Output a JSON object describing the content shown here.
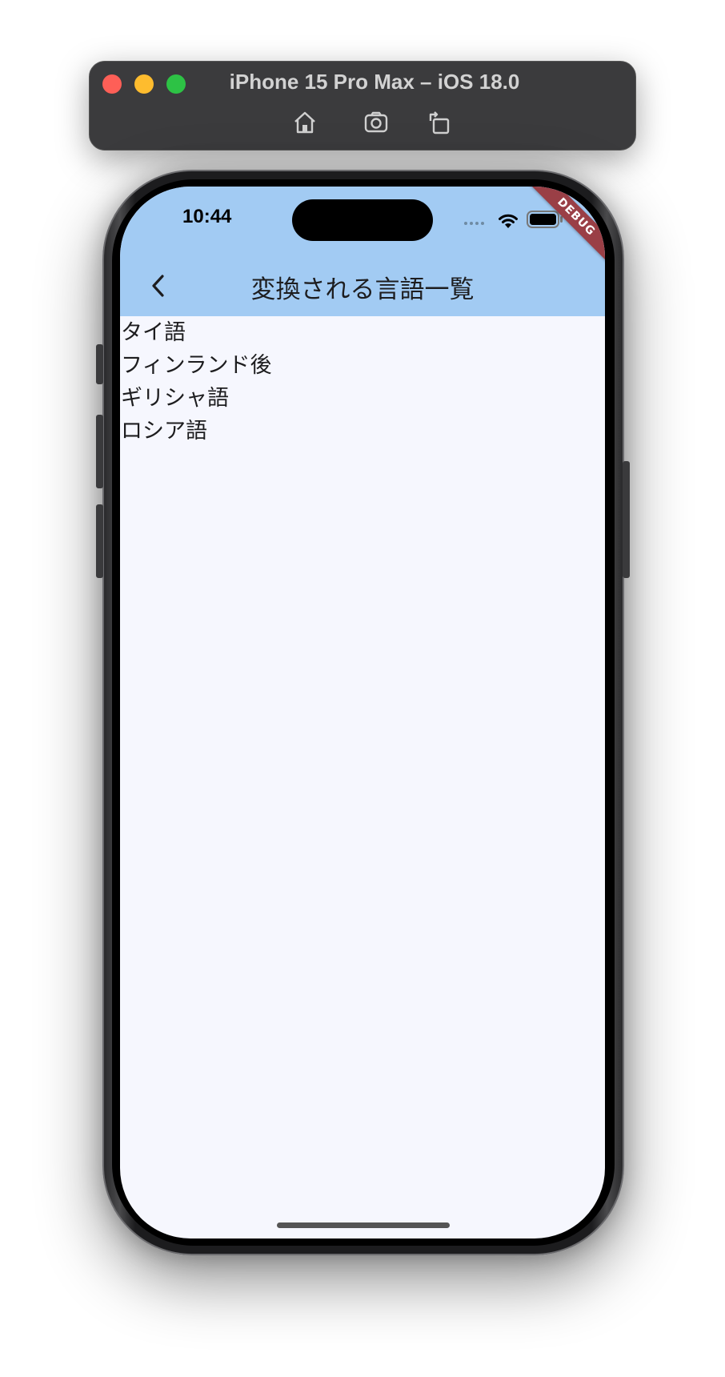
{
  "simulator": {
    "title": "iPhone 15 Pro Max – iOS 18.0",
    "buttons": [
      "home-icon",
      "screenshot-icon",
      "rotate-icon"
    ]
  },
  "status_bar": {
    "time": "10:44"
  },
  "debug_banner": "DEBUG",
  "app_bar": {
    "title": "変換される言語一覧",
    "back_icon": "chevron-left-icon"
  },
  "languages": [
    "タイ語",
    "フィンランド後",
    "ギリシャ語",
    "ロシア語"
  ],
  "colors": {
    "app_bar": "#a2cbf3",
    "background": "#f6f7fe",
    "debug_banner": "#9a3f46"
  }
}
